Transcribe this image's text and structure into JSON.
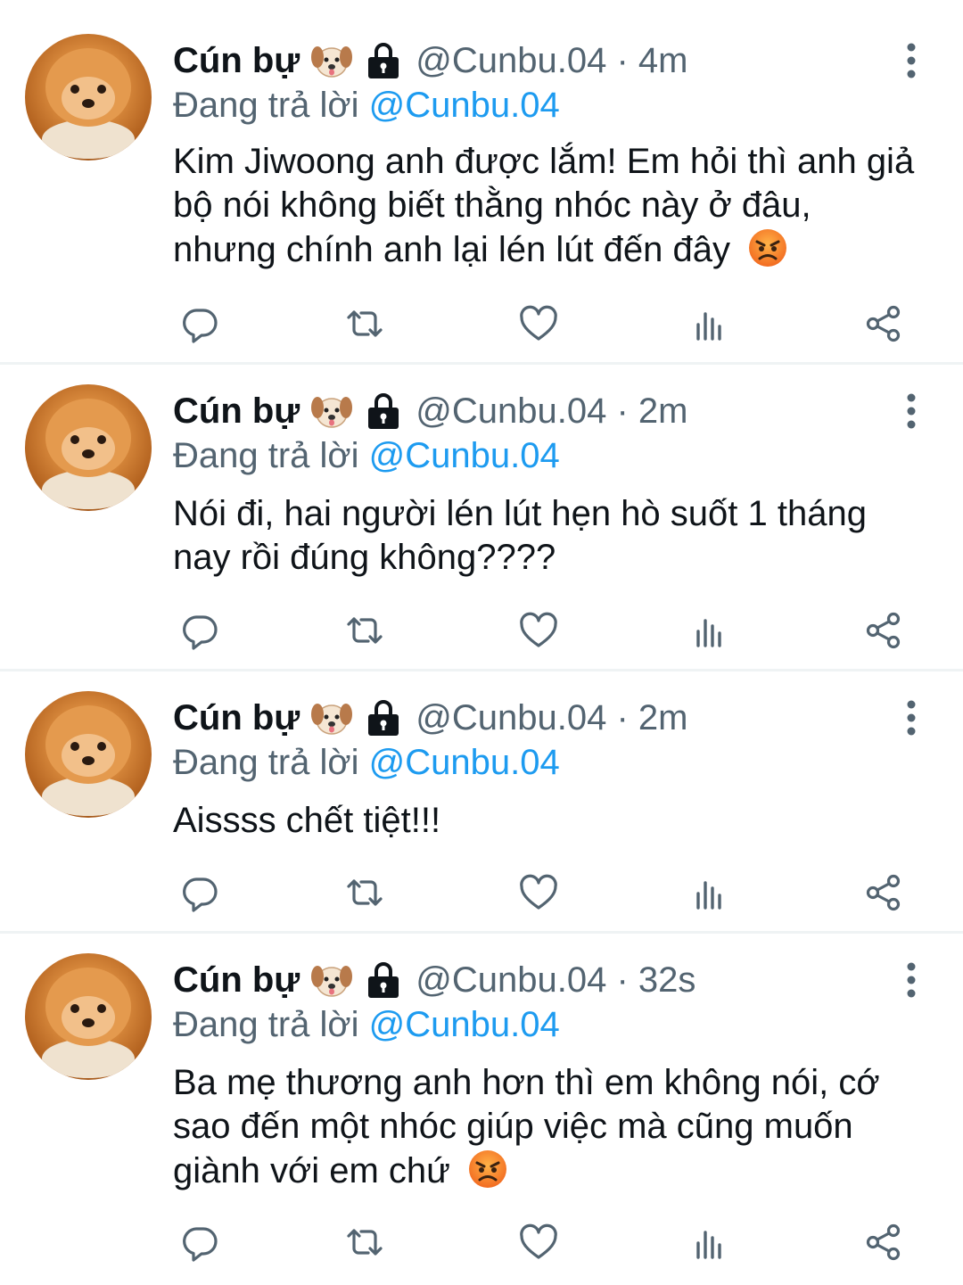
{
  "tweets": [
    {
      "name": "Cún bự",
      "name_emoji": "dog-face-emoji",
      "handle_time": "@Cunbu.04 · 4m",
      "reply_prefix": "Đang trả lời",
      "reply_mention": "@Cunbu.04",
      "text": "Kim Jiwoong anh được lắm! Em hỏi thì anh giả bộ nói không biết thằng nhóc này ở đâu, nhưng chính anh lại lén lút đến đây",
      "trailing_emoji": "angry-face-emoji"
    },
    {
      "name": "Cún bự",
      "name_emoji": "dog-face-emoji",
      "handle_time": "@Cunbu.04 · 2m",
      "reply_prefix": "Đang trả lời",
      "reply_mention": "@Cunbu.04",
      "text": "Nói đi, hai người lén lút hẹn hò suốt 1 tháng nay rồi đúng không????",
      "trailing_emoji": ""
    },
    {
      "name": "Cún bự",
      "name_emoji": "dog-face-emoji",
      "handle_time": "@Cunbu.04 · 2m",
      "reply_prefix": "Đang trả lời",
      "reply_mention": "@Cunbu.04",
      "text": "Aissss chết tiệt!!!",
      "trailing_emoji": ""
    },
    {
      "name": "Cún bự",
      "name_emoji": "dog-face-emoji",
      "handle_time": "@Cunbu.04 · 32s",
      "reply_prefix": "Đang trả lời",
      "reply_mention": "@Cunbu.04",
      "text": "Ba mẹ thương anh hơn thì em không nói, cớ sao đến một nhóc giúp việc mà cũng muốn giành với em chứ",
      "trailing_emoji": "angry-face-emoji"
    }
  ],
  "icons": {
    "protected": "lock-icon",
    "more": "more-vertical-icon",
    "reply": "reply-icon",
    "retweet": "retweet-icon",
    "like": "like-icon",
    "views": "views-icon",
    "share": "share-icon"
  },
  "colors": {
    "text": "#0f1419",
    "secondary": "#536471",
    "mention": "#1d9bf0",
    "divider": "#eff3f4"
  }
}
